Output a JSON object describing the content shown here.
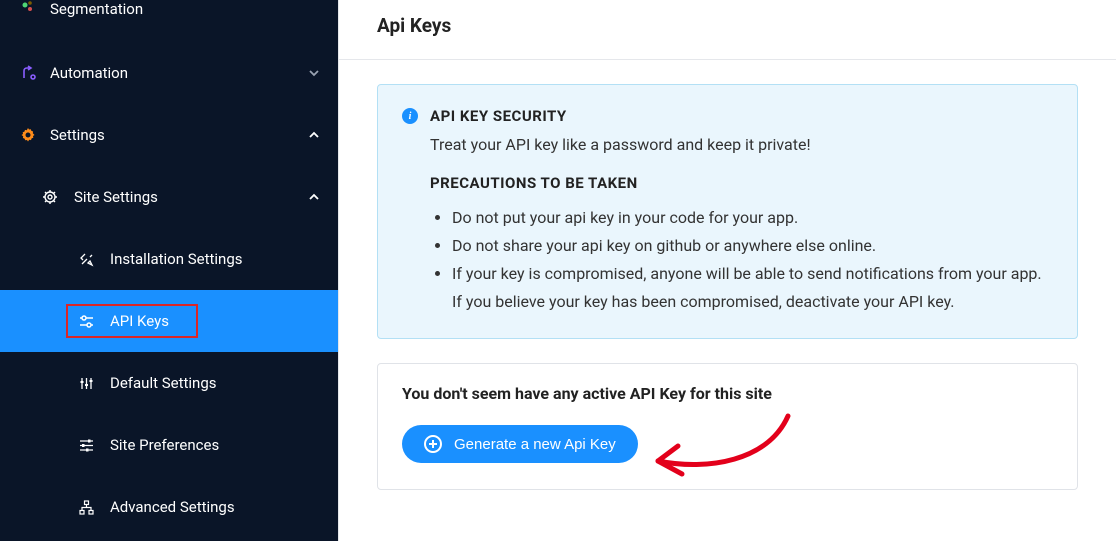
{
  "sidebar": {
    "segmentation": "Segmentation",
    "automation": "Automation",
    "settings": "Settings",
    "site_settings": "Site Settings",
    "items": {
      "installation": "Installation Settings",
      "api_keys": "API Keys",
      "default": "Default Settings",
      "preferences": "Site Preferences",
      "advanced": "Advanced Settings"
    }
  },
  "page": {
    "title": "Api Keys"
  },
  "alert": {
    "title": "API KEY SECURITY",
    "desc": "Treat your API key like a password and keep it private!",
    "subheading": "PRECAUTIONS TO BE TAKEN",
    "bullets": [
      "Do not put your api key in your code for your app.",
      "Do not share your api key on github or anywhere else online.",
      "If your key is compromised, anyone will be able to send notifications from your app. If you believe your key has been compromised, deactivate your API key."
    ]
  },
  "card": {
    "empty_title": "You don't seem have any active API Key for this site",
    "button_label": "Generate a new Api Key"
  }
}
